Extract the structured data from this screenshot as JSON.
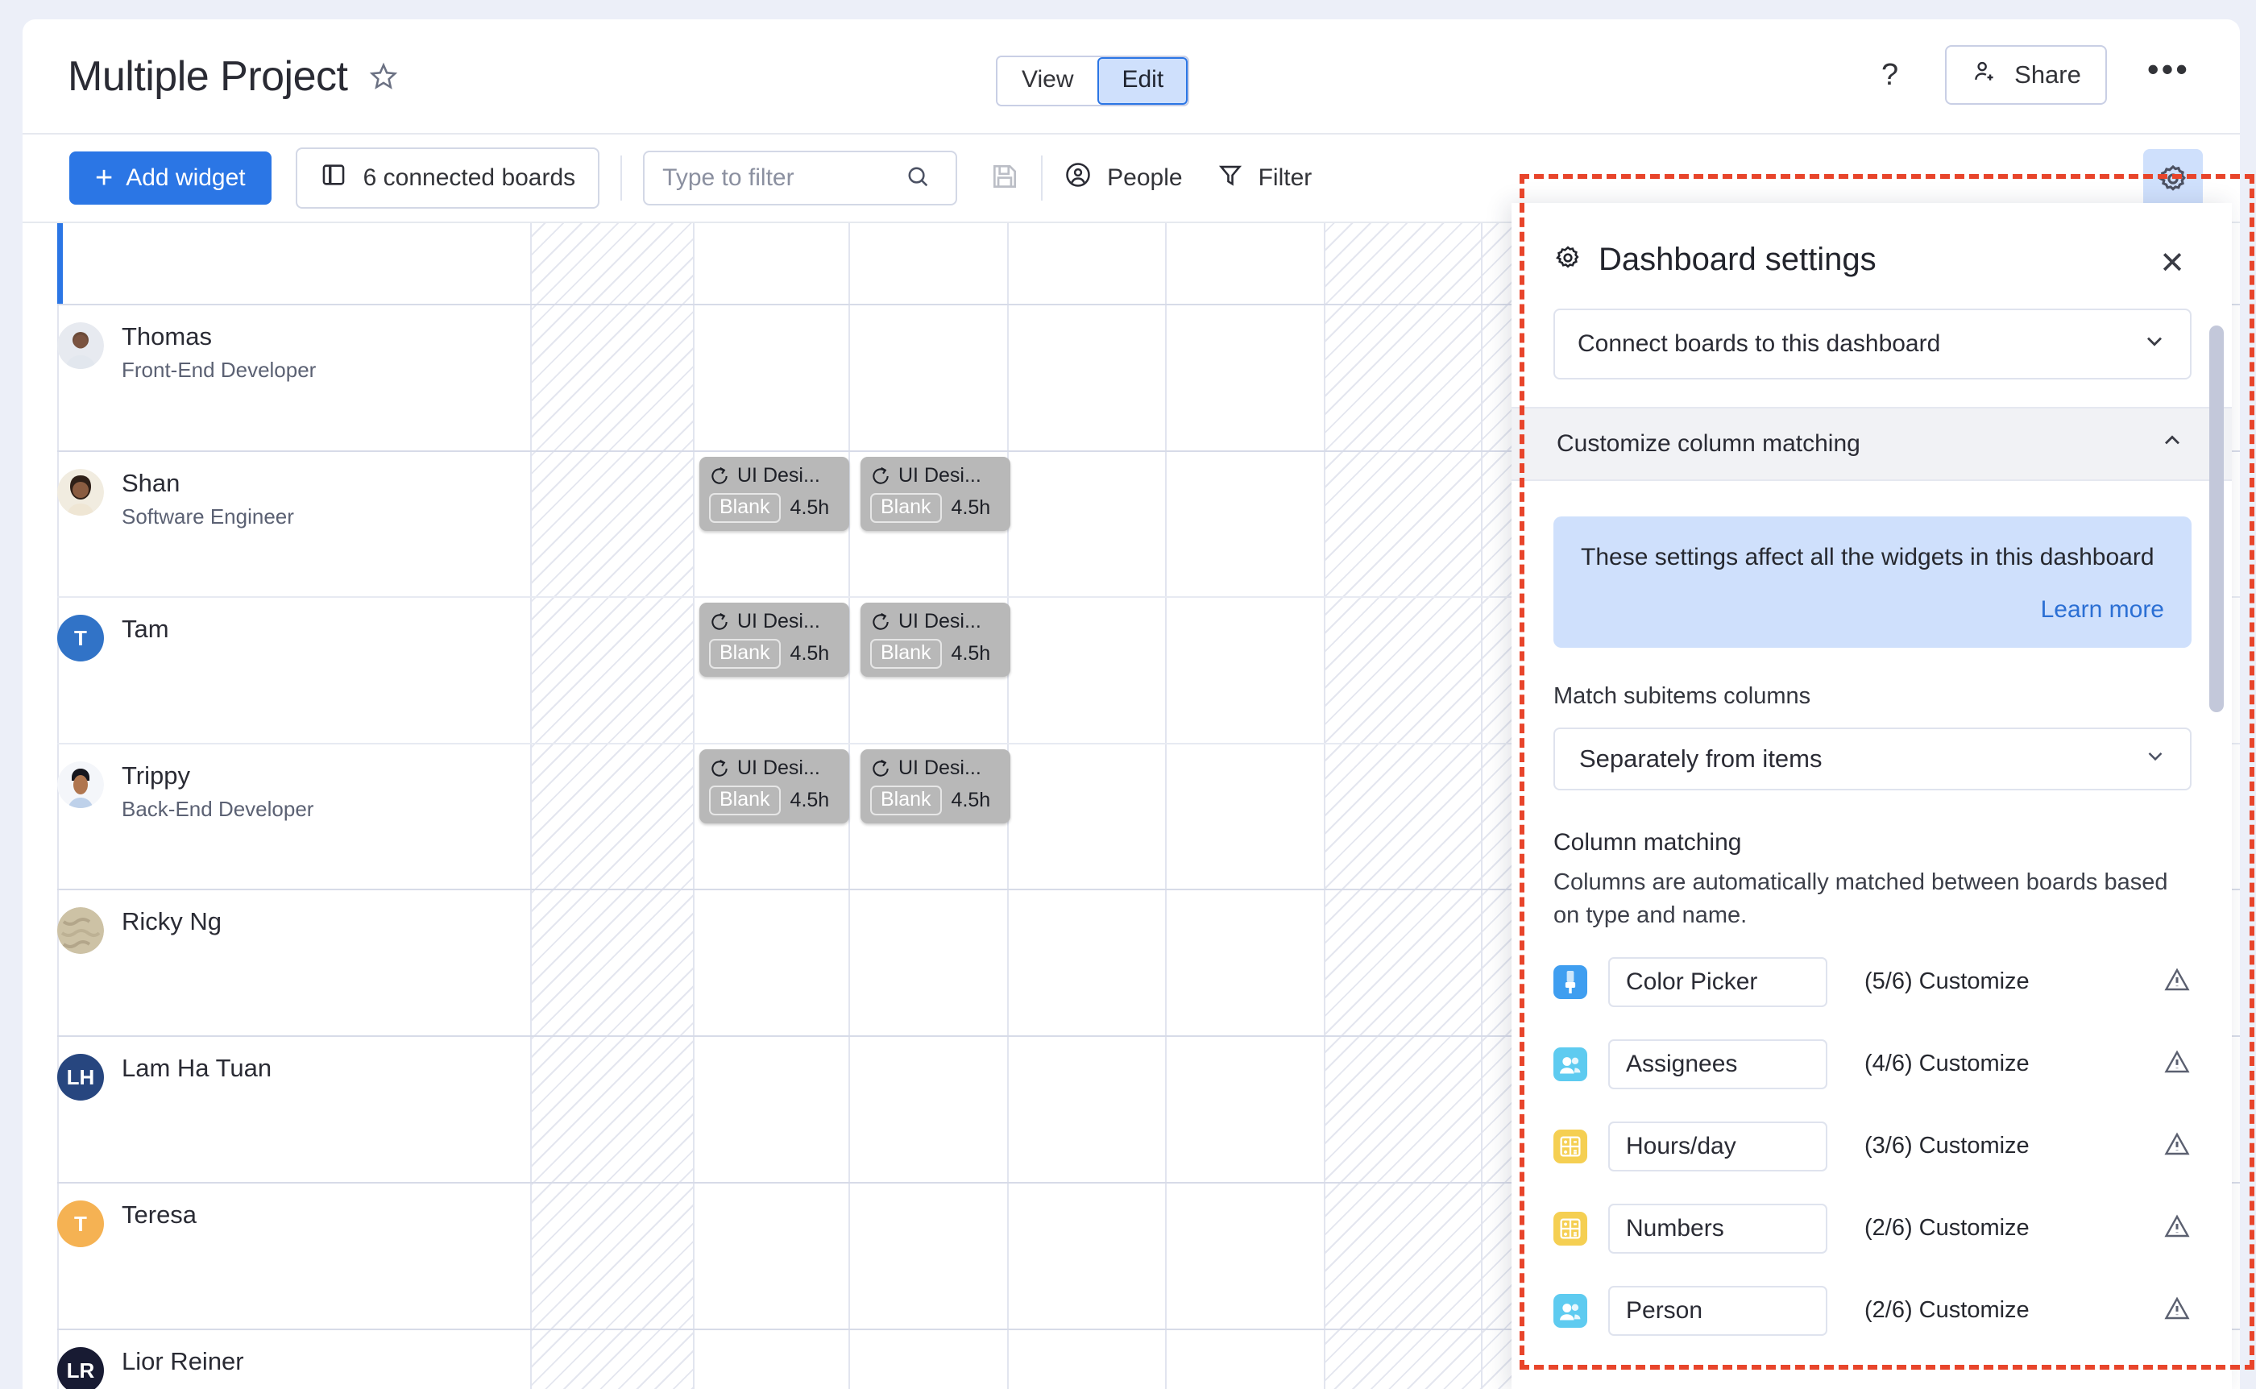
{
  "header": {
    "title": "Multiple Project",
    "star_icon": "star-outline-icon",
    "view_label": "View",
    "edit_label": "Edit",
    "help_label": "?",
    "share_label": "Share",
    "more_label": "•••"
  },
  "toolbar": {
    "add_widget_label": "Add widget",
    "plus": "+",
    "connected_boards_label": "6 connected boards",
    "filter_placeholder": "Type to filter",
    "filter_value": "",
    "people_label": "People",
    "filter_label": "Filter",
    "gear_icon": "gear-icon"
  },
  "grid": {
    "people": [
      {
        "name": "Thomas",
        "role": "Front-End Developer",
        "avatar_type": "photo",
        "avatar_color": "#d8dde6",
        "initials": ""
      },
      {
        "name": "Shan",
        "role": "Software Engineer",
        "avatar_type": "photo",
        "avatar_color": "#d9c9ad",
        "initials": ""
      },
      {
        "name": "Tam",
        "role": "",
        "avatar_type": "initials",
        "avatar_color": "#3173c7",
        "initials": "T"
      },
      {
        "name": "Trippy",
        "role": "Back-End Developer",
        "avatar_type": "photo",
        "avatar_color": "#cfdcef",
        "initials": ""
      },
      {
        "name": "Ricky Ng",
        "role": "",
        "avatar_type": "photo",
        "avatar_color": "#cdc2a5",
        "initials": ""
      },
      {
        "name": "Lam Ha Tuan",
        "role": "",
        "avatar_type": "initials",
        "avatar_color": "#27467f",
        "initials": "LH"
      },
      {
        "name": "Teresa",
        "role": "",
        "avatar_type": "initials",
        "avatar_color": "#f5b253",
        "initials": "T"
      },
      {
        "name": "Lior Reiner",
        "role": "",
        "avatar_type": "initials",
        "avatar_color": "#181b33",
        "initials": "LR"
      }
    ],
    "card": {
      "title": "UI Desi...",
      "status": "Blank",
      "hours": "4.5h",
      "timer_icon": "timer-icon"
    }
  },
  "panel": {
    "gear_icon": "gear-icon",
    "title": "Dashboard settings",
    "close": "✕",
    "connect_boards_label": "Connect boards to this dashboard",
    "customize_label": "Customize column matching",
    "notice_text": "These settings affect all the widgets in this dashboard",
    "learn_more": "Learn more",
    "match_subitems_label": "Match subitems columns",
    "match_subitems_value": "Separately from items",
    "column_matching_title": "Column matching",
    "column_matching_desc": "Columns are automatically matched between boards based on type and name.",
    "rows": [
      {
        "name": "Color Picker",
        "count": "(5/6) Customize",
        "icon": "color-picker-icon",
        "icon_color": "#3f9ef0",
        "warn": "warning-icon"
      },
      {
        "name": "Assignees",
        "count": "(4/6) Customize",
        "icon": "people-icon",
        "icon_color": "#5ecbf0",
        "warn": "warning-icon"
      },
      {
        "name": "Hours/day",
        "count": "(3/6) Customize",
        "icon": "numbers-icon",
        "icon_color": "#f5cf52",
        "warn": "warning-icon"
      },
      {
        "name": "Numbers",
        "count": "(2/6) Customize",
        "icon": "numbers-icon",
        "icon_color": "#f5cf52",
        "warn": "warning-icon"
      },
      {
        "name": "Person",
        "count": "(2/6) Customize",
        "icon": "people-icon",
        "icon_color": "#5ecbf0",
        "warn": "warning-icon"
      }
    ]
  },
  "colors": {
    "accent": "#2b76e5",
    "selected_bg": "#cfe0fc",
    "highlight_outline": "#e8452b",
    "card_bg": "#b8b8b8"
  }
}
